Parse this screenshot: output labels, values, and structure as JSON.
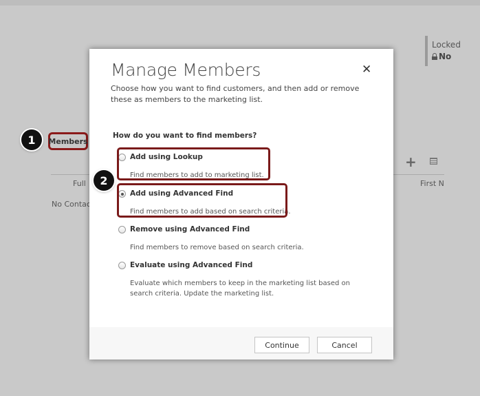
{
  "background": {
    "locked_label": "Locked",
    "locked_value": "No",
    "members_tab": "Members",
    "col_full": "Full",
    "col_first": "First N",
    "no_contacts": "No Contac"
  },
  "callouts": [
    "1",
    "2"
  ],
  "dialog": {
    "title": "Manage Members",
    "description": "Choose how you want to find customers, and then add or remove these as members to the marketing list.",
    "question": "How do you want to find members?",
    "options": [
      {
        "label": "Add using Lookup",
        "description": "Find members to add to marketing list.",
        "selected": false
      },
      {
        "label": "Add using Advanced Find",
        "description": "Find members to add based on search criteria.",
        "selected": true
      },
      {
        "label": "Remove using Advanced Find",
        "description": "Find members to remove based on search criteria.",
        "selected": false
      },
      {
        "label": "Evaluate using Advanced Find",
        "description": "Evaluate which members to keep in the marketing list based on search criteria. Update the marketing list.",
        "selected": false
      }
    ],
    "continue_label": "Continue",
    "cancel_label": "Cancel"
  },
  "colors": {
    "highlight": "#7a1a1a",
    "overlay": "#c9c9c9"
  }
}
